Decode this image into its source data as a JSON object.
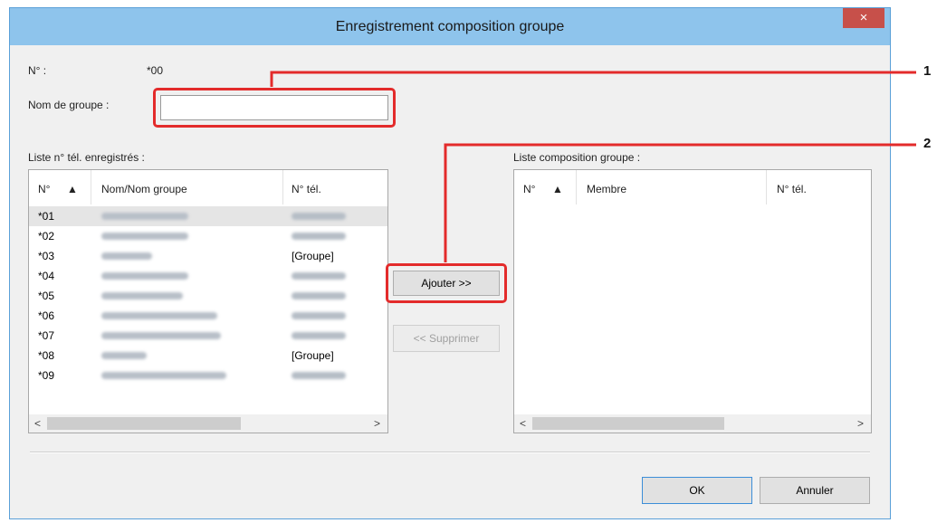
{
  "dialog": {
    "title": "Enregistrement composition groupe",
    "close_label": "×"
  },
  "form": {
    "no_label": "N° :",
    "no_value": "*00",
    "group_name_label": "Nom de groupe :",
    "group_name_value": ""
  },
  "registered_list": {
    "label": "Liste n° tél. enregistrés :",
    "columns": [
      "N°",
      "Nom/Nom groupe",
      "N° tél."
    ],
    "rows": [
      {
        "no": "*01",
        "tel": ""
      },
      {
        "no": "*02",
        "tel": ""
      },
      {
        "no": "*03",
        "tel": "[Groupe]"
      },
      {
        "no": "*04",
        "tel": ""
      },
      {
        "no": "*05",
        "tel": ""
      },
      {
        "no": "*06",
        "tel": ""
      },
      {
        "no": "*07",
        "tel": ""
      },
      {
        "no": "*08",
        "tel": "[Groupe]"
      },
      {
        "no": "*09",
        "tel": ""
      }
    ]
  },
  "composition_list": {
    "label": "Liste composition groupe :",
    "columns": [
      "N°",
      "Membre",
      "N° tél."
    ]
  },
  "buttons": {
    "add": "Ajouter >>",
    "remove": "<< Supprimer",
    "ok": "OK",
    "cancel": "Annuler"
  },
  "callouts": [
    "1",
    "2"
  ],
  "colors": {
    "titlebar": "#8ec4ec",
    "close": "#c7504a",
    "highlight": "#e32b2b"
  }
}
